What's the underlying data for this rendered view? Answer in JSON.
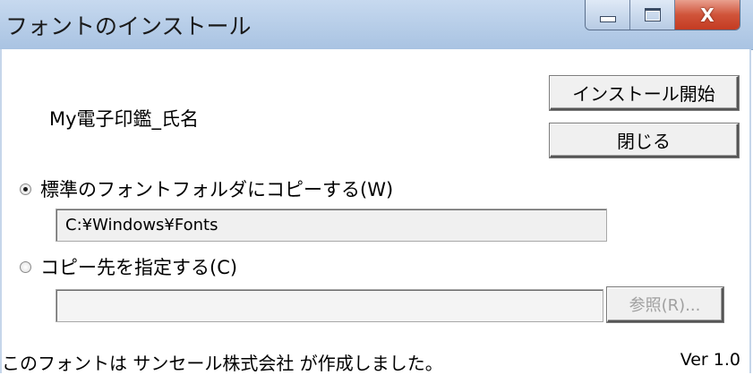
{
  "window": {
    "title": "フォントのインストール",
    "controls": {
      "minimize": "minimize-icon",
      "maximize": "maximize-icon",
      "close": "close-icon",
      "close_glyph": "X"
    }
  },
  "font_name": "My電子印鑑_氏名",
  "buttons": {
    "install_start": "インストール開始",
    "close": "閉じる",
    "browse": "参照(R)..."
  },
  "options": {
    "standard_folder_label": "標準のフォントフォルダにコピーする(W)",
    "standard_folder_path": "C:¥Windows¥Fonts",
    "custom_dest_label": "コピー先を指定する(C)",
    "custom_dest_path": "",
    "selected": "standard"
  },
  "footer": {
    "credit": "このフォントは サンセール株式会社 が作成しました。",
    "version": "Ver 1.0"
  }
}
